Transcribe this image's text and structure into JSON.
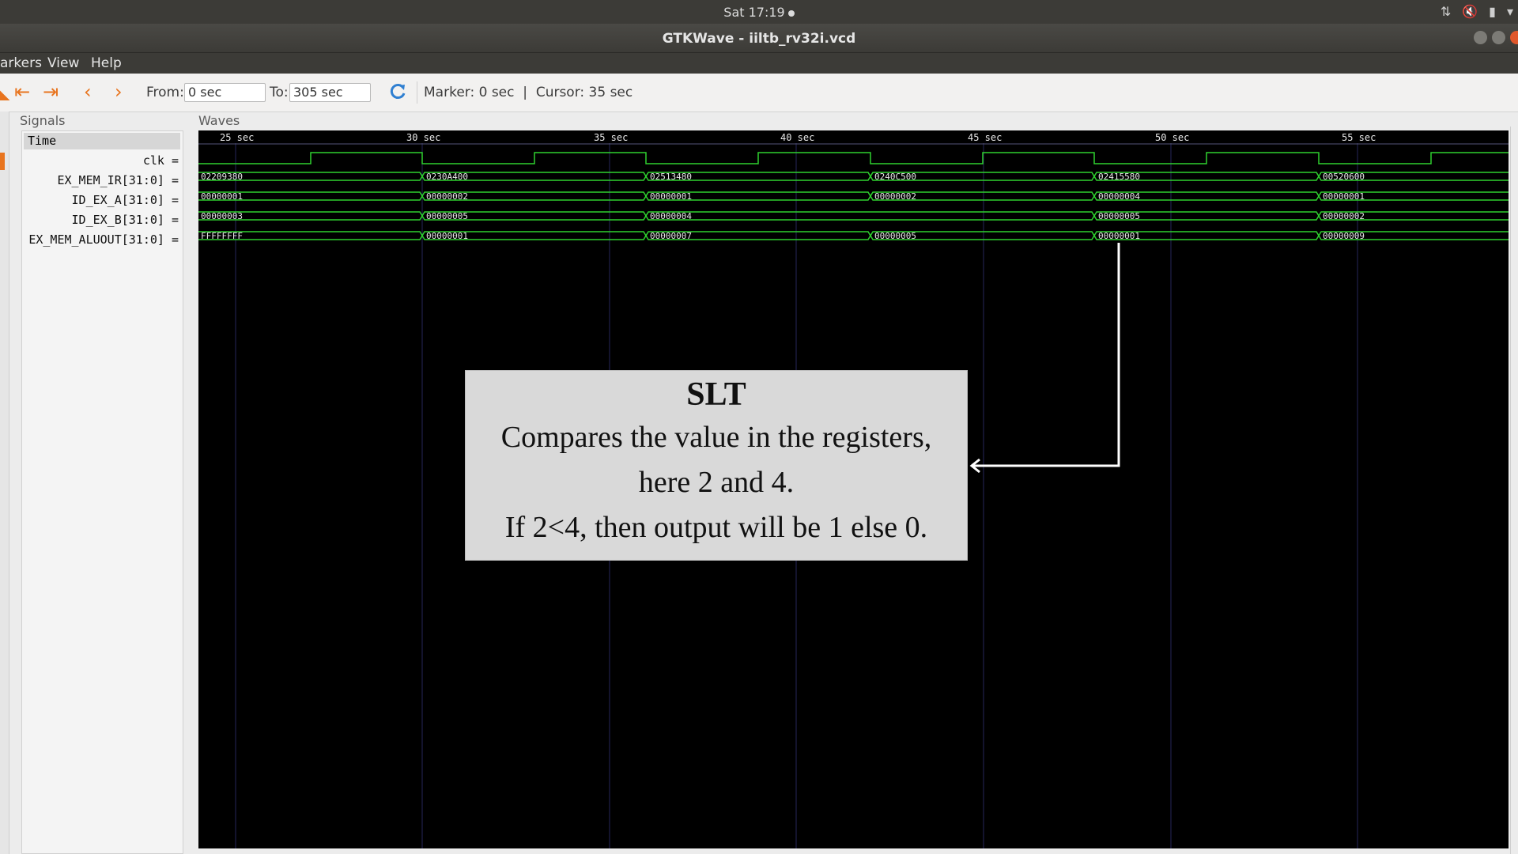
{
  "system_bar": {
    "clock": "Sat 17:19"
  },
  "window": {
    "title": "GTKWave - iiltb_rv32i.vcd"
  },
  "menu": {
    "items": [
      "arkers",
      "View",
      "Help"
    ]
  },
  "toolbar": {
    "from_label": "From:",
    "from_value": "0 sec",
    "to_label": "To:",
    "to_value": "305 sec",
    "status": "Marker: 0 sec  |  Cursor: 35 sec"
  },
  "signals_panel": {
    "title": "Signals",
    "time_header": "Time",
    "signals": [
      "clk =",
      "EX_MEM_IR[31:0] =",
      "ID_EX_A[31:0] =",
      "ID_EX_B[31:0] =",
      "EX_MEM_ALUOUT[31:0] ="
    ]
  },
  "waves_panel": {
    "title": "Waves",
    "ticks": [
      "25 sec",
      "30 sec",
      "35 sec",
      "40 sec",
      "45 sec",
      "50 sec",
      "55 sec"
    ],
    "bus_rows": [
      {
        "signal": "EX_MEM_IR[31:0]",
        "values": [
          "02209380",
          "0230A400",
          "02513480",
          "0240C500",
          "02415580",
          "00520600"
        ]
      },
      {
        "signal": "ID_EX_A[31:0]",
        "values": [
          "00000001",
          "00000002",
          "00000001",
          "00000002",
          "00000004",
          "00000001"
        ]
      },
      {
        "signal": "ID_EX_B[31:0]",
        "values": [
          "00000003",
          "00000005",
          "00000004",
          "",
          "00000005",
          "00000002"
        ]
      },
      {
        "signal": "EX_MEM_ALUOUT[31:0]",
        "values": [
          "FFFFFFFF",
          "00000001",
          "00000007",
          "00000005",
          "00000001",
          "00000009"
        ]
      }
    ],
    "colors": {
      "trace": "#2fd12f",
      "grid": "#26265a",
      "background": "#000000"
    }
  },
  "annotation": {
    "title": "SLT",
    "lines": [
      "Compares the value in the registers,",
      "here 2 and 4.",
      "If 2<4, then output will be 1 else 0."
    ]
  }
}
